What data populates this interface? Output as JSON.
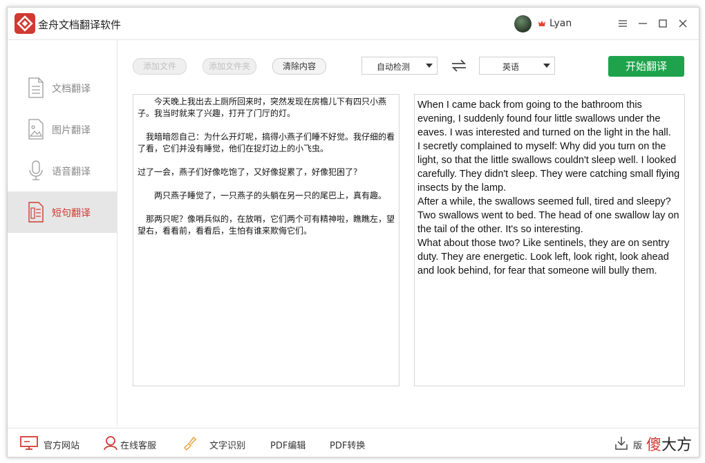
{
  "app": {
    "title": "金舟文档翻译软件",
    "user_name": "Lyan"
  },
  "sidebar": {
    "items": [
      {
        "label": "文档翻译",
        "icon": "document-icon",
        "active": false
      },
      {
        "label": "图片翻译",
        "icon": "image-icon",
        "active": false
      },
      {
        "label": "语音翻译",
        "icon": "microphone-icon",
        "active": false
      },
      {
        "label": "短句翻译",
        "icon": "text-document-icon",
        "active": true
      }
    ]
  },
  "toolbar": {
    "add_file": "添加文件",
    "add_folder": "添加文件夹",
    "clear": "清除内容",
    "source_lang": "自动检测",
    "target_lang": "英语",
    "start": "开始翻译"
  },
  "source": {
    "paragraphs": [
      "　　今天晚上我出去上厕所回来时，突然发现在房檐儿下有四只小燕子。我当时就来了兴趣，打开了门厅的灯。",
      "　我暗暗怨自己：为什么开灯呢，搞得小燕子们睡不好觉。我仔细的看了看，它们并没有睡觉，他们在捉灯边上的小飞虫。",
      "过了一会，燕子们好像吃饱了，又好像捉累了，好像犯困了？",
      "　　两只燕子睡觉了，一只燕子的头躺在另一只的尾巴上，真有趣。",
      "　那两只呢？像哨兵似的，在放哨，它们两个可有精神啦，瞧瞧左，望望右，看看前，看看后，生怕有谁来欺侮它们。"
    ]
  },
  "target": {
    "paragraphs": [
      "When I came back from going to the bathroom this evening, I suddenly found four little swallows under the eaves. I was interested and turned on the light in the hall.",
      "I secretly complained to myself: Why did you turn on the light, so that the little swallows couldn't sleep well. I looked carefully. They didn't sleep. They were catching small flying insects by the lamp.",
      "After a while, the swallows seemed full, tired and sleepy? Two swallows went to bed. The head of one swallow lay on the tail of the other. It's so interesting.",
      "What about those two? Like sentinels, they are on sentry duty. They are energetic. Look left, look right, look ahead and look behind, for fear that someone will bully them."
    ]
  },
  "bottom": {
    "website": "官方网站",
    "support": "在线客服",
    "ocr": "文字识别",
    "pdf_edit": "PDF编辑",
    "pdf_convert": "PDF转换",
    "version": "版",
    "watermark_red": "傻",
    "watermark_black": "大方"
  },
  "colors": {
    "brand_red": "#d03a32",
    "start_green": "#1ea34c",
    "active_bg": "#e6e6e6"
  }
}
